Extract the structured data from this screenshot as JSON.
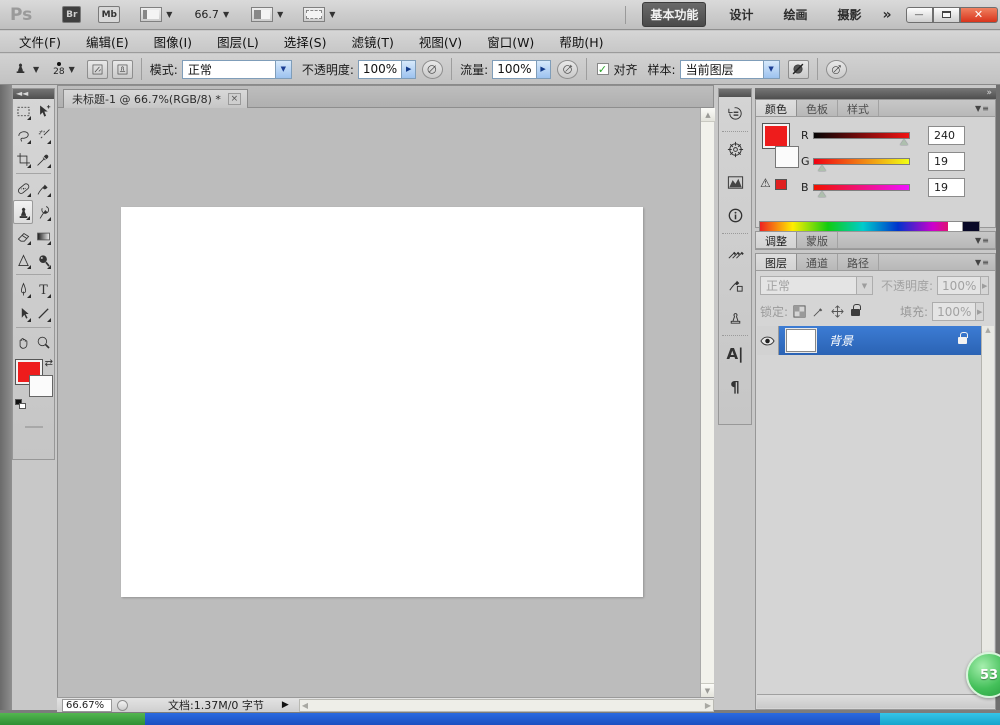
{
  "titlebar": {
    "logo": "Ps",
    "bridge_label": "Br",
    "mini_bridge_label": "Mb",
    "zoom_level": "66.7",
    "workspaces": [
      "基本功能",
      "设计",
      "绘画",
      "摄影"
    ],
    "workspace_overflow": "»",
    "minimize_glyph": "—",
    "close_glyph": "✕"
  },
  "menubar": {
    "items": [
      "文件(F)",
      "编辑(E)",
      "图像(I)",
      "图层(L)",
      "选择(S)",
      "滤镜(T)",
      "视图(V)",
      "窗口(W)",
      "帮助(H)"
    ]
  },
  "options": {
    "brush_size": "28",
    "mode_label": "模式:",
    "mode_value": "正常",
    "opacity_label": "不透明度:",
    "opacity_value": "100%",
    "flow_label": "流量:",
    "flow_value": "100%",
    "align_label": "对齐",
    "align_check": "✓",
    "sample_label": "样本:",
    "sample_value": "当前图层"
  },
  "document": {
    "tab_title": "未标题-1 @ 66.7%(RGB/8) *",
    "close_glyph": "×"
  },
  "tool_panel": {
    "collapse_glyph": "◄◄"
  },
  "panel_dock": {
    "collapse_glyph": "»",
    "color_panel": {
      "tabs": [
        "颜色",
        "色板",
        "样式"
      ],
      "r_label": "R",
      "r_value": "240",
      "g_label": "G",
      "g_value": "19",
      "b_label": "B",
      "b_value": "19",
      "warning_glyph": "⚠"
    },
    "adjust_panel": {
      "tabs": [
        "调整",
        "蒙版"
      ]
    },
    "layers_panel": {
      "tabs": [
        "图层",
        "通道",
        "路径"
      ],
      "blend_mode": "正常",
      "opacity_label": "不透明度:",
      "opacity_value": "100%",
      "lock_label": "锁定:",
      "fill_label": "填充:",
      "fill_value": "100%",
      "layer_name": "背景"
    }
  },
  "statusbar": {
    "zoom": "66.67%",
    "doc_info": "文档:1.37M/0 字节",
    "flyout_glyph": "▶"
  },
  "overlay_badge": {
    "value": "53"
  },
  "colors": {
    "foreground_red": "#ee1c1c",
    "layer_selection_blue": "#2f6fc4",
    "badge_green": "#44c05a"
  }
}
